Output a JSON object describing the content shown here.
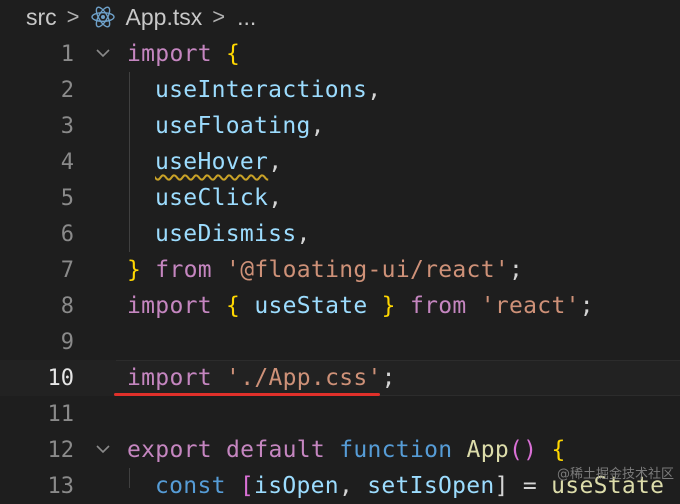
{
  "breadcrumb": {
    "folder": "src",
    "separator": ">",
    "file": "App.tsx",
    "ellipsis": "...",
    "icon": "react-icon"
  },
  "editor": {
    "active_line": 10,
    "lines": [
      {
        "n": "1",
        "t1": "import",
        "t2": " {"
      },
      {
        "n": "2",
        "t1": "useInteractions",
        "t2": ","
      },
      {
        "n": "3",
        "t1": "useFloating",
        "t2": ","
      },
      {
        "n": "4",
        "t1": "useHover",
        "t2": ","
      },
      {
        "n": "5",
        "t1": "useClick",
        "t2": ","
      },
      {
        "n": "6",
        "t1": "useDismiss",
        "t2": ","
      },
      {
        "n": "7",
        "t1": "}",
        "t2": " from ",
        "t3": "'@floating-ui/react'",
        "t4": ";"
      },
      {
        "n": "8",
        "t1": "import",
        "t2": " {",
        "t3": " useState ",
        "t4": "}",
        "t5": " from ",
        "t6": "'react'",
        "t7": ";"
      },
      {
        "n": "9"
      },
      {
        "n": "10",
        "t1": "import",
        "t2": " ",
        "t3": "'./App.css'",
        "t4": ";"
      },
      {
        "n": "11"
      },
      {
        "n": "12",
        "t1": "export",
        "t2": " default ",
        "t3": "function",
        "t4": " App",
        "t5": "()",
        "t6": " {"
      },
      {
        "n": "13",
        "t1": "const",
        "t2": " [",
        "t3": "isOpen",
        "t4": ", ",
        "t5": "setIsOpen",
        "t6": "] = ",
        "t7": "useState"
      }
    ]
  },
  "watermark": "@稀土掘金技术社区",
  "colors": {
    "background": "#1e1e1e",
    "keyword": "#c586c0",
    "storage": "#569cd6",
    "variable": "#9cdcfe",
    "function": "#dcdcaa",
    "string": "#ce9178",
    "bracket": "#ffd700",
    "annotation_underline": "#e0302a"
  }
}
